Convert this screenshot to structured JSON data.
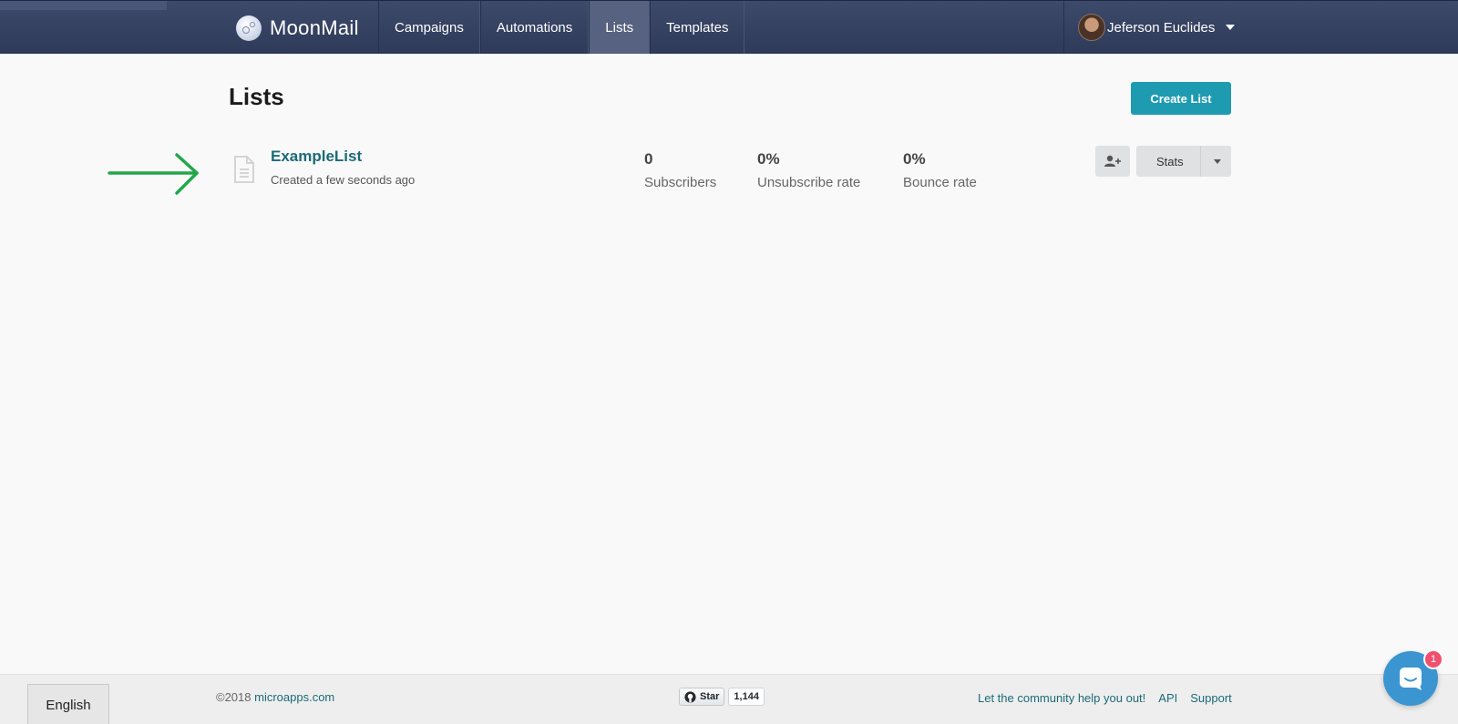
{
  "nav": {
    "brand": "MoonMail",
    "items": [
      {
        "label": "Campaigns",
        "active": false
      },
      {
        "label": "Automations",
        "active": false
      },
      {
        "label": "Lists",
        "active": true
      },
      {
        "label": "Templates",
        "active": false
      }
    ],
    "user_name": "Jeferson Euclides"
  },
  "page": {
    "title": "Lists",
    "create_button": "Create List"
  },
  "list": {
    "name": "ExampleList",
    "created": "Created a few seconds ago",
    "stats": [
      {
        "value": "0",
        "label": "Subscribers"
      },
      {
        "value": "0%",
        "label": "Unsubscribe rate"
      },
      {
        "value": "0%",
        "label": "Bounce rate"
      }
    ],
    "stats_button": "Stats"
  },
  "footer": {
    "language": "English",
    "copyright_prefix": "©2018",
    "copyright_link": "microapps.com",
    "github_star": "Star",
    "github_count": "1,144",
    "links": [
      "Let the community help you out!",
      "API",
      "Support"
    ]
  },
  "chat": {
    "badge": "1"
  },
  "colors": {
    "accent": "#1e9bb0",
    "nav_bg": "#2e3a58",
    "arrow": "#22a84a",
    "badge": "#f0506e"
  }
}
